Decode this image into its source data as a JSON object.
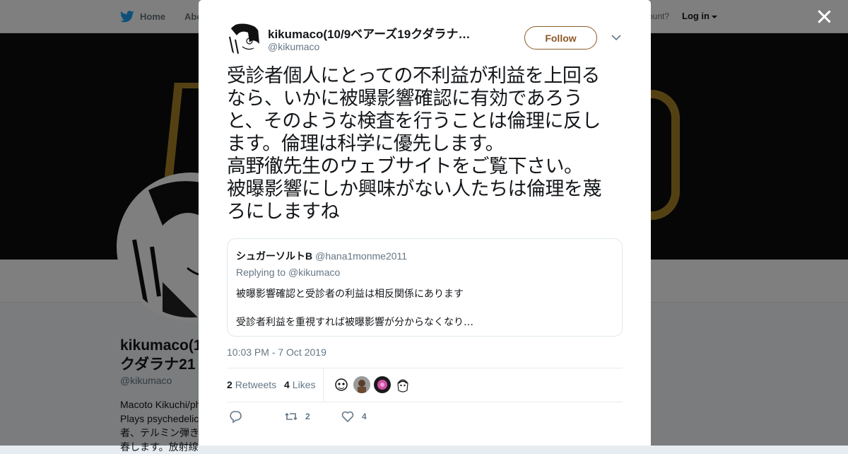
{
  "topbar": {
    "home_label": "Home",
    "about_label": "Abo",
    "account_prompt": "ccount?",
    "login_label": "Log in"
  },
  "profile": {
    "name": "kikumaco(1\nクダラナ21",
    "handle": "@kikumaco",
    "bio_line1": "Macoto Kikuchi/ph",
    "bio_line2": "Plays psychedelic",
    "bio_line3": "者、テルミン弾き",
    "bio_line4": "春します。放射線"
  },
  "tweet": {
    "author_name": "kikumaco(10/9ベアーズ19クダラナ…",
    "author_handle": "@kikumaco",
    "follow_label": "Follow",
    "text_lines": [
      "受診者個人にとっての不利益が利益を上回る",
      "なら、いかに被曝影響確認に有効であろう",
      "と、そのような検査を行うことは倫理に反し",
      "ます。倫理は科学に優先します。",
      "高野徹先生のウェブサイトをご覧下さい。",
      "被曝影響にしか興味がない人たちは倫理を蔑",
      "ろにしますね"
    ],
    "timestamp": "10:03 PM - 7 Oct 2019",
    "retweets_count": "2",
    "retweets_label": "Retweets",
    "likes_count": "4",
    "likes_label": "Likes",
    "action_retweet_count": "2",
    "action_like_count": "4"
  },
  "quoted": {
    "name": "シュガーソルトB",
    "handle": "@hana1monme2011",
    "replying_prefix": "Replying to",
    "replying_to": "@kikumaco",
    "line1": "被曝影響確認と受診者の利益は相反関係にあります",
    "line2": "受診者利益を重視すれば被曝影響が分からなくなり…"
  },
  "colors": {
    "twitter_blue": "#1da1f2",
    "follow_accent": "#8c5a2a",
    "banner_gold": "#a88326"
  },
  "icons": [
    "twitter-bird-icon",
    "close-icon",
    "chevron-down-icon",
    "reply-icon",
    "retweet-icon",
    "heart-icon"
  ]
}
